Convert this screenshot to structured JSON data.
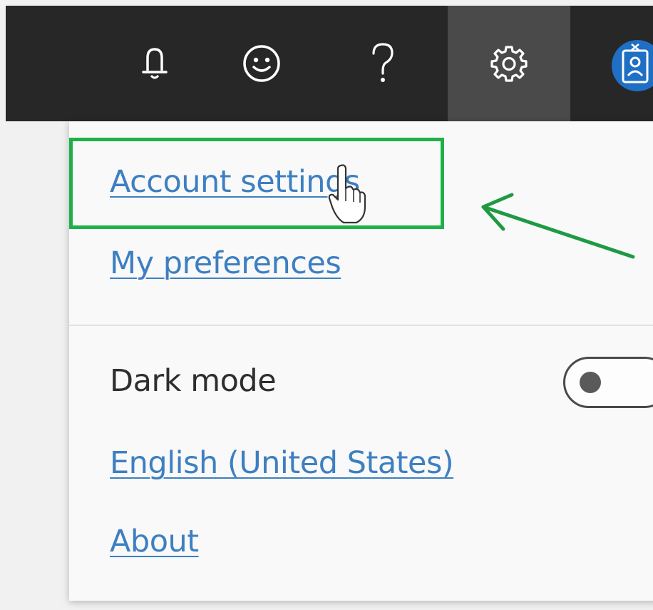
{
  "topbar": {
    "icons": [
      {
        "name": "bell-icon"
      },
      {
        "name": "smiley-icon"
      },
      {
        "name": "help-icon"
      },
      {
        "name": "gear-icon"
      }
    ],
    "background": "#272727",
    "active_background": "#4a4a4a",
    "avatar_color": "#1f6fc4"
  },
  "menu": {
    "account_settings": "Account settings",
    "my_preferences": "My preferences",
    "dark_mode": "Dark mode",
    "dark_mode_enabled": false,
    "language": "English (United States)",
    "about": "About"
  },
  "colors": {
    "link": "#3d7fc1",
    "highlight": "#20b04a",
    "arrow": "#1f9a44"
  }
}
